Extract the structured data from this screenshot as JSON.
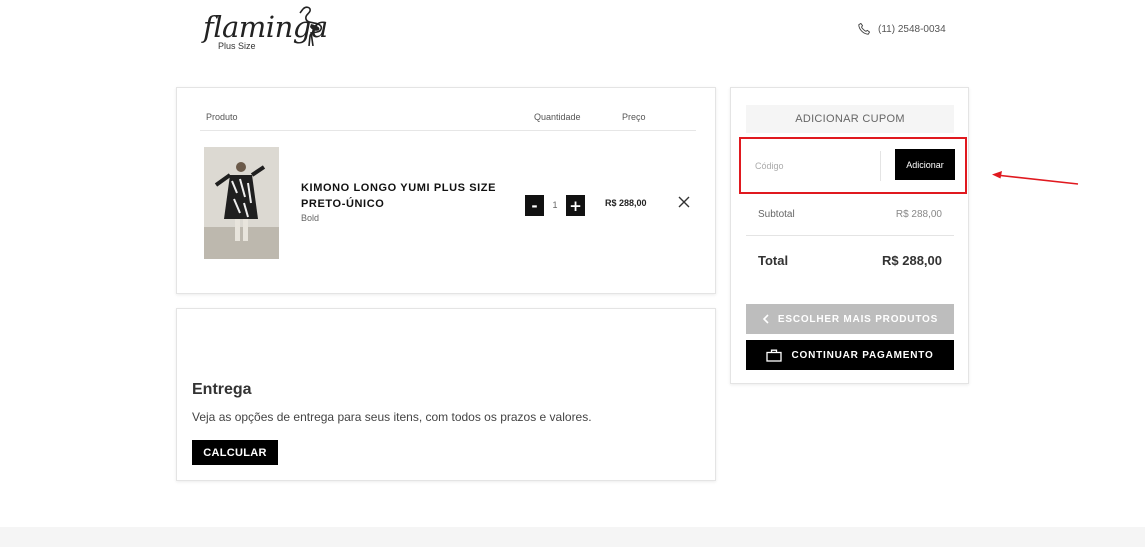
{
  "header": {
    "logo_text": "flaminga",
    "logo_sub": "Plus Size",
    "phone": "(11) 2548-0034"
  },
  "cart": {
    "columns": {
      "product": "Produto",
      "quantity": "Quantidade",
      "price": "Preço"
    },
    "item": {
      "name": "KIMONO LONGO YUMI PLUS SIZE PRETO-ÚNICO",
      "variant": "Bold",
      "quantity": "1",
      "minus": "-",
      "plus": "+",
      "price": "R$ 288,00"
    }
  },
  "shipping": {
    "title": "Entrega",
    "description": "Veja as opções de entrega para seus itens, com todos os prazos e valores.",
    "button": "CALCULAR"
  },
  "summary": {
    "coupon_title": "ADICIONAR CUPOM",
    "coupon_placeholder": "Código",
    "coupon_button": "Adicionar",
    "subtotal_label": "Subtotal",
    "subtotal_value": "R$ 288,00",
    "total_label": "Total",
    "total_value": "R$ 288,00",
    "more_products": "ESCOLHER MAIS PRODUTOS",
    "continue_payment": "CONTINUAR PAGAMENTO"
  },
  "colors": {
    "highlight": "#e0191f",
    "primary_button": "#000000",
    "secondary_button": "#bdbdbd"
  }
}
